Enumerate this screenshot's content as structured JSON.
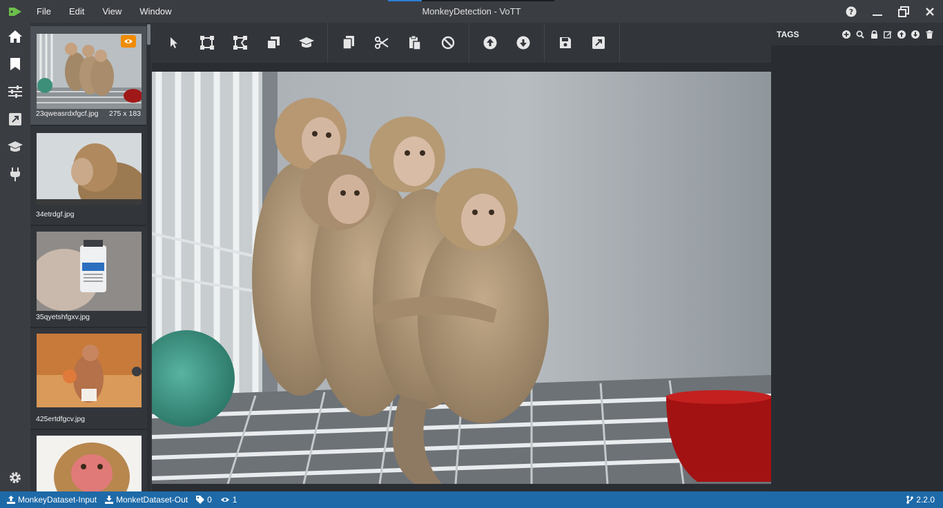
{
  "window": {
    "title": "MonkeyDetection - VoTT",
    "menu": [
      "File",
      "Edit",
      "View",
      "Window"
    ]
  },
  "leftnav": {
    "items": [
      "home-icon",
      "bookmark-icon",
      "sliders-icon",
      "export-icon",
      "graduation-cap-icon",
      "plug-icon"
    ],
    "settings": "gear-icon"
  },
  "thumbnails": [
    {
      "name": "23qweasrdxfgcf.jpg",
      "size": "275 x 183",
      "active": true,
      "visited": true
    },
    {
      "name": "34etrdgf.jpg",
      "size": ""
    },
    {
      "name": "35qyetshfgxv.jpg",
      "size": ""
    },
    {
      "name": "425ertdfgcv.jpg",
      "size": ""
    },
    {
      "name": "",
      "size": ""
    }
  ],
  "toolbar": {
    "groups": [
      [
        "pointer-icon",
        "rectangle-icon",
        "polygon-icon",
        "copy-rectangle-icon",
        "active-learning-icon"
      ],
      [
        "copy-icon",
        "cut-icon",
        "paste-icon",
        "clear-icon"
      ],
      [
        "previous-asset-icon",
        "next-asset-icon"
      ],
      [
        "save-icon",
        "export-icon"
      ]
    ]
  },
  "tags_pane": {
    "title": "TAGS",
    "tools": [
      "add-tag-icon",
      "search-tag-icon",
      "lock-tag-icon",
      "edit-tag-icon",
      "move-tag-up-icon",
      "move-tag-down-icon",
      "delete-tag-icon"
    ]
  },
  "statusbar": {
    "source": "MonkeyDataset-Input",
    "target": "MonketDataset-Out",
    "tag_count": "0",
    "visited_count": "1",
    "version": "2.2.0"
  },
  "colors": {
    "accent": "#1e6aa8",
    "badge": "#f08c00",
    "logo": "#6cc04a"
  }
}
